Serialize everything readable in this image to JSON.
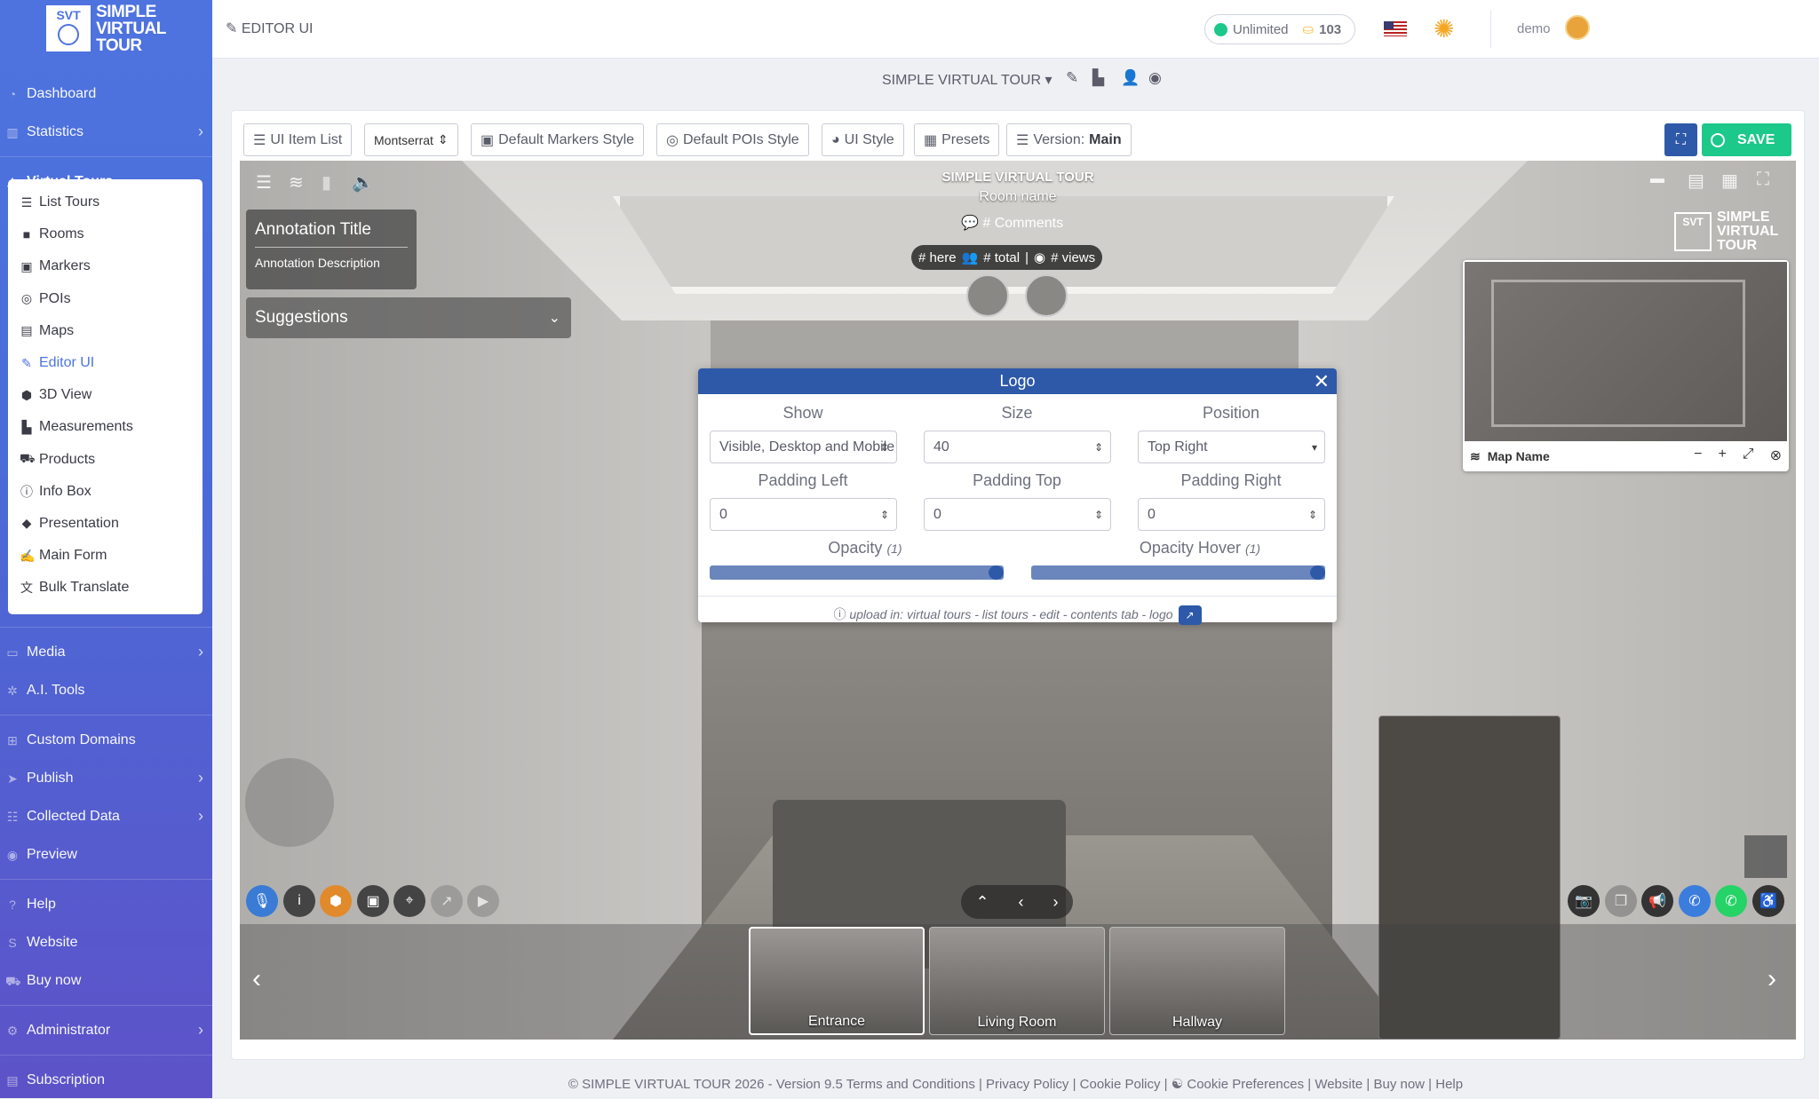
{
  "brand": {
    "badge": "SVT",
    "line1": "SIMPLE",
    "line2": "VIRTUAL",
    "line3": "TOUR"
  },
  "sidebar": {
    "items_top": [
      {
        "label": "Dashboard",
        "icon": "dashboard-icon"
      },
      {
        "label": "Statistics",
        "icon": "chart-icon",
        "chevron": "›"
      },
      {
        "label": "Virtual Tours",
        "icon": "tours-icon",
        "chevron": "⌄"
      }
    ],
    "submenu": [
      {
        "label": "List Tours",
        "icon": "list-icon"
      },
      {
        "label": "Rooms",
        "icon": "square-icon"
      },
      {
        "label": "Markers",
        "icon": "image-icon"
      },
      {
        "label": "POIs",
        "icon": "bullseye-icon"
      },
      {
        "label": "Maps",
        "icon": "map-icon"
      },
      {
        "label": "Editor UI",
        "icon": "editor-icon"
      },
      {
        "label": "3D View",
        "icon": "cube-icon"
      },
      {
        "label": "Measurements",
        "icon": "ruler-icon"
      },
      {
        "label": "Products",
        "icon": "cart-icon"
      },
      {
        "label": "Info Box",
        "icon": "info-icon"
      },
      {
        "label": "Presentation",
        "icon": "diamond-icon"
      },
      {
        "label": "Main Form",
        "icon": "form-icon"
      },
      {
        "label": "Bulk Translate",
        "icon": "translate-icon"
      }
    ],
    "items_bottom": [
      {
        "label": "Media",
        "chevron": "›"
      },
      {
        "label": "A.I. Tools"
      },
      {
        "label": "Custom Domains"
      },
      {
        "label": "Publish",
        "chevron": "›"
      },
      {
        "label": "Collected Data",
        "chevron": "›"
      },
      {
        "label": "Preview"
      },
      {
        "label": "Help"
      },
      {
        "label": "Website"
      },
      {
        "label": "Buy now"
      },
      {
        "label": "Administrator",
        "chevron": "›"
      },
      {
        "label": "Subscription"
      }
    ]
  },
  "topbar": {
    "page_title": "EDITOR UI",
    "credits_label": "Unlimited",
    "credits_count": "103",
    "user": "demo"
  },
  "tour": {
    "name": "SIMPLE VIRTUAL TOUR ▾"
  },
  "toolbar": {
    "ui_item_list": "UI Item List",
    "font": "Montserrat",
    "markers_style": "Default Markers Style",
    "pois_style": "Default POIs Style",
    "ui_style": "UI Style",
    "presets": "Presets",
    "version_label": "Version:",
    "version_value": "Main",
    "save": "SAVE"
  },
  "viewer": {
    "title": "SIMPLE VIRTUAL TOUR",
    "room": "Room name",
    "comments": "# Comments",
    "here": "# here",
    "total": "# total",
    "views": "# views",
    "annotation_title": "Annotation Title",
    "annotation_desc": "Annotation Description",
    "suggestions": "Suggestions",
    "logo_l1": "SIMPLE",
    "logo_l2": "VIRTUAL",
    "logo_l3": "TOUR",
    "logo_badge": "SVT",
    "map_name": "Map Name",
    "rooms": [
      {
        "label": "Entrance"
      },
      {
        "label": "Living Room"
      },
      {
        "label": "Hallway"
      }
    ]
  },
  "logo_modal": {
    "title": "Logo",
    "show_label": "Show",
    "show_value": "Visible, Desktop and Mobile",
    "size_label": "Size",
    "size_value": "40",
    "position_label": "Position",
    "position_value": "Top Right",
    "pad_left_label": "Padding Left",
    "pad_left_value": "0",
    "pad_top_label": "Padding Top",
    "pad_top_value": "0",
    "pad_right_label": "Padding Right",
    "pad_right_value": "0",
    "opacity_label": "Opacity",
    "opacity_value": "(1)",
    "opacity_hover_label": "Opacity Hover",
    "opacity_hover_value": "(1)",
    "opacity_level": 1,
    "opacity_hover_level": 1,
    "note": "upload in: virtual tours - list tours - edit - contents tab - logo"
  },
  "footer": "© SIMPLE VIRTUAL TOUR 2026 - Version 9.5     Terms and Conditions | Privacy Policy | Cookie Policy | ☯ Cookie Preferences | Website | Buy now | Help",
  "colors": {
    "primary": "#4e73df",
    "dark_blue": "#2e59a8",
    "green": "#1cc88a"
  }
}
